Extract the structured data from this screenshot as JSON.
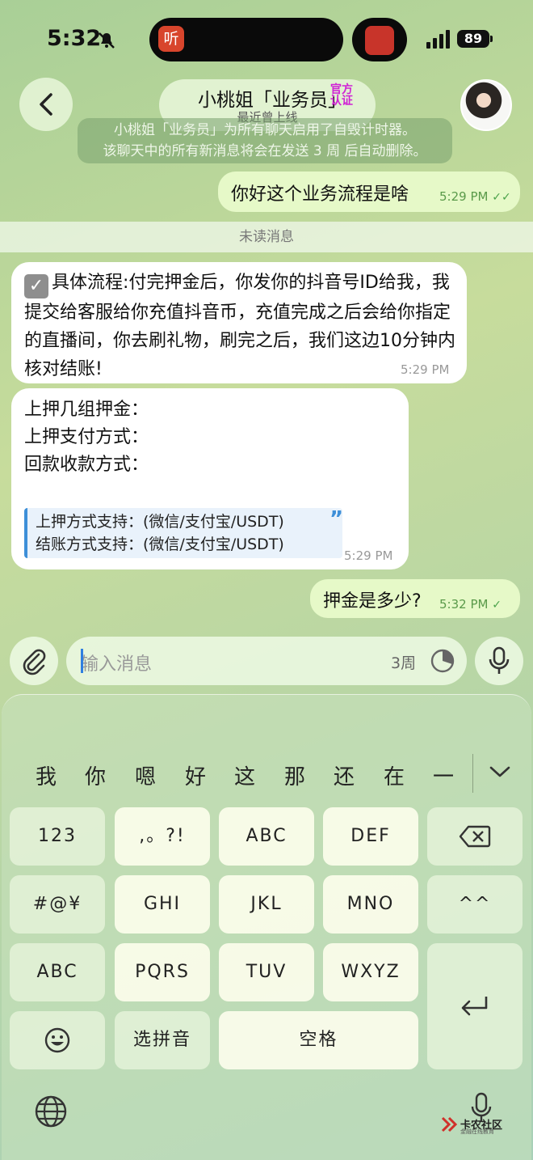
{
  "status_bar": {
    "time": "5:32",
    "island_app_label": "听",
    "battery": "89"
  },
  "header": {
    "title": "小桃姐「业务员」",
    "badge_line1": "官方",
    "badge_line2": "认证",
    "subtitle": "最近曾上线",
    "back_icon": "chevron-left-icon",
    "avatar_icon": "avatar"
  },
  "system_notice": {
    "line1": "小桃姐「业务员」为所有聊天启用了自毁计时器。",
    "line2": "该聊天中的所有新消息将会在发送 3 周 后自动删除。"
  },
  "unread_divider": "未读消息",
  "messages": [
    {
      "direction": "out",
      "text": "你好这个业务流程是啥",
      "time": "5:29 PM",
      "status": "read"
    },
    {
      "direction": "in",
      "text": "具体流程:付完押金后，你发你的抖音号ID给我，我提交给客服给你充值抖音币，充值完成之后会给你指定的直播间，你去刷礼物，刷完之后，我们这边10分钟内核对结账!",
      "time": "5:29 PM"
    },
    {
      "direction": "in",
      "lines": [
        "上押几组押金：",
        "上押支付方式：",
        "回款收款方式："
      ],
      "quote": [
        "上押方式支持：(微信/支付宝/USDT)",
        "结账方式支持：(微信/支付宝/USDT)"
      ],
      "time": "5:29 PM"
    },
    {
      "direction": "out",
      "text": "押金是多少?",
      "time": "5:32 PM",
      "status": "sent"
    }
  ],
  "composer": {
    "placeholder": "输入消息",
    "timer": "3周"
  },
  "keyboard": {
    "candidates": [
      "我",
      "你",
      "嗯",
      "好",
      "这",
      "那",
      "还",
      "在",
      "一"
    ],
    "rows": [
      [
        "123",
        ",。?!",
        "ABC",
        "DEF"
      ],
      [
        "#@¥",
        "GHI",
        "JKL",
        "MNO",
        "^^"
      ],
      [
        "ABC",
        "PQRS",
        "TUV",
        "WXYZ"
      ],
      [
        "选拼音",
        "空格"
      ]
    ]
  },
  "watermark": {
    "text": "卡农社区",
    "sub": "金融在线教育"
  },
  "colors": {
    "out_bubble": "#e6f9c8",
    "in_bubble": "#ffffff",
    "accent": "#3d8fd8",
    "badge": "#d021d5"
  }
}
